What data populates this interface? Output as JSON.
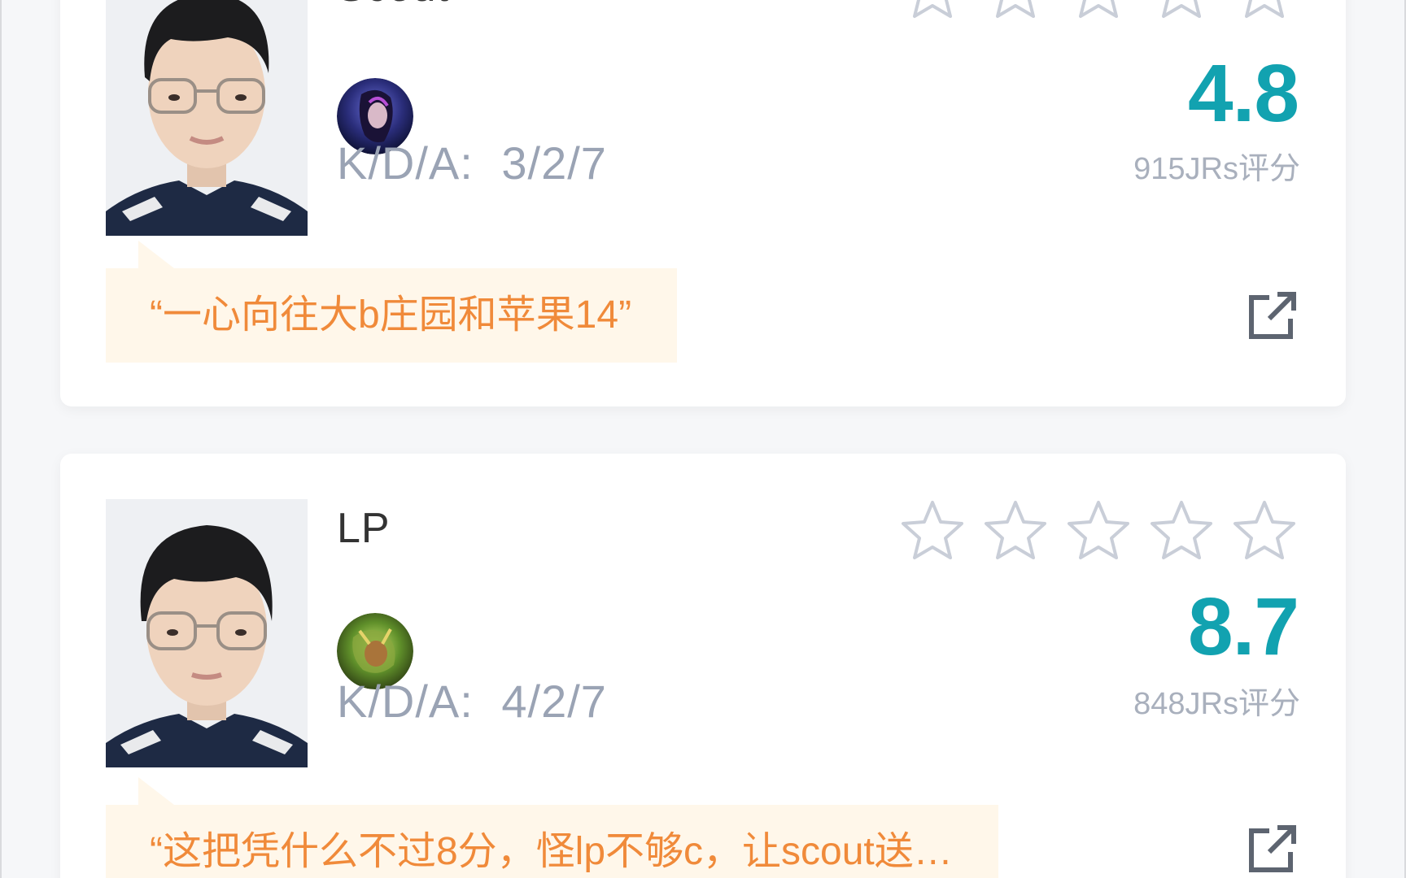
{
  "players": [
    {
      "name": "Scout",
      "kda_label": "K/D/A:",
      "kda": "3/2/7",
      "score": "4.8",
      "votes": "915JRs评分",
      "quote": "“一心向往大b庄园和苹果14”",
      "stars_filled": 0,
      "stars_total": 5,
      "photo_icon": "player-photo",
      "champion_icon": "champion-avatar"
    },
    {
      "name": "LP",
      "kda_label": "K/D/A:",
      "kda": "4/2/7",
      "score": "8.7",
      "votes": "848JRs评分",
      "quote": "“这把凭什么不过8分，怪lp不够c，让scout送…",
      "stars_filled": 0,
      "stars_total": 5,
      "photo_icon": "player-photo",
      "champion_icon": "champion-avatar"
    }
  ],
  "colors": {
    "score": "#12a2b0",
    "quote_text": "#f08a3a",
    "quote_bg": "#fff7ea",
    "muted": "#9aa3b4",
    "star_stroke": "#c9ced8"
  },
  "icons": {
    "star": "star-outline-icon",
    "share": "share-external-icon"
  }
}
